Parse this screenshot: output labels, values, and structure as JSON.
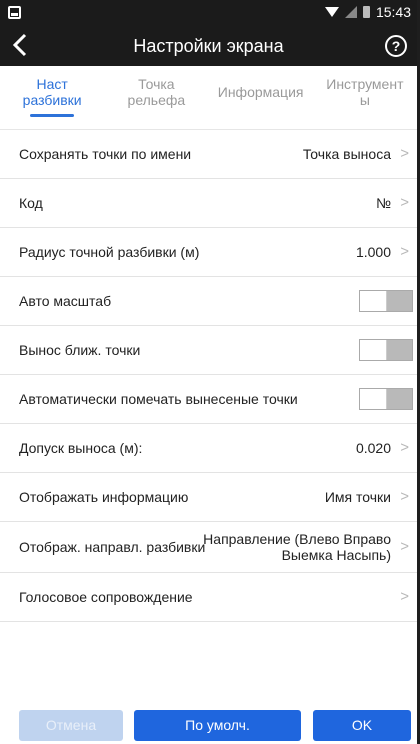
{
  "status_bar": {
    "time": "15:43"
  },
  "header": {
    "back_icon": "back-arrow-icon",
    "title": "Настройки экрана",
    "help_icon": "help-circle-icon",
    "help_glyph": "?"
  },
  "tabs": [
    {
      "label": "Наст\nразбивки",
      "active": true
    },
    {
      "label": "Точка\nрельефа",
      "active": false
    },
    {
      "label": "Информация",
      "active": false
    },
    {
      "label": "Инструмент\nы",
      "active": false
    }
  ],
  "settings": [
    {
      "label": "Сохранять точки по имени",
      "value": "Точка выноса",
      "chevron": true
    },
    {
      "label": "Код",
      "value": "№",
      "chevron": true
    },
    {
      "label": "Радиус точной разбивки (м)",
      "value": "1.000",
      "chevron": true
    },
    {
      "label": "Авто масштаб",
      "toggle": false
    },
    {
      "label": "Вынос ближ. точки",
      "toggle": false
    },
    {
      "label": "Автоматически помечать вынесеные точки",
      "toggle": false
    },
    {
      "label": "Допуск выноса (м):",
      "value": "0.020",
      "chevron": true
    },
    {
      "label": "Отображать информацию",
      "value": "Имя точки",
      "chevron": true
    },
    {
      "label": "Отображ. направл. разбивки",
      "value_line1": "Направление (Влево Вправо",
      "value_line2": "Выемка Насыпь)",
      "chevron": true
    },
    {
      "label": "Голосовое сопровождение",
      "value": "",
      "chevron": true
    }
  ],
  "footer": {
    "cancel_label": "Отмена",
    "default_label": "По умолч.",
    "ok_label": "OK"
  },
  "colors": {
    "accent": "#2d72d9",
    "button": "#1f66de",
    "button_disabled": "#bfd3ef",
    "bar": "#1b1b1b"
  }
}
